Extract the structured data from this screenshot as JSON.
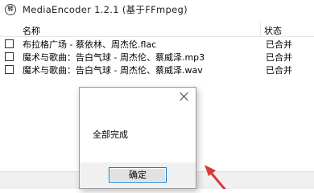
{
  "window": {
    "icon_label": "转",
    "title": "MediaEncoder 1.2.1 (基于FFmpeg)"
  },
  "list": {
    "columns": {
      "name": "名称",
      "status": "状态"
    },
    "rows": [
      {
        "name": "布拉格广场 - 蔡依林、周杰伦.flac",
        "status": "已合并"
      },
      {
        "name": "魔术与歌曲：告白气球 - 周杰伦、蔡威泽.mp3",
        "status": "已合并"
      },
      {
        "name": "魔术与歌曲：告白气球 - 周杰伦、蔡威泽.wav",
        "status": "已合并"
      }
    ]
  },
  "dialog": {
    "message": "全部完成",
    "ok_label": "确定"
  },
  "colors": {
    "accent": "#0078d7",
    "pointer": "#d63a3a"
  }
}
